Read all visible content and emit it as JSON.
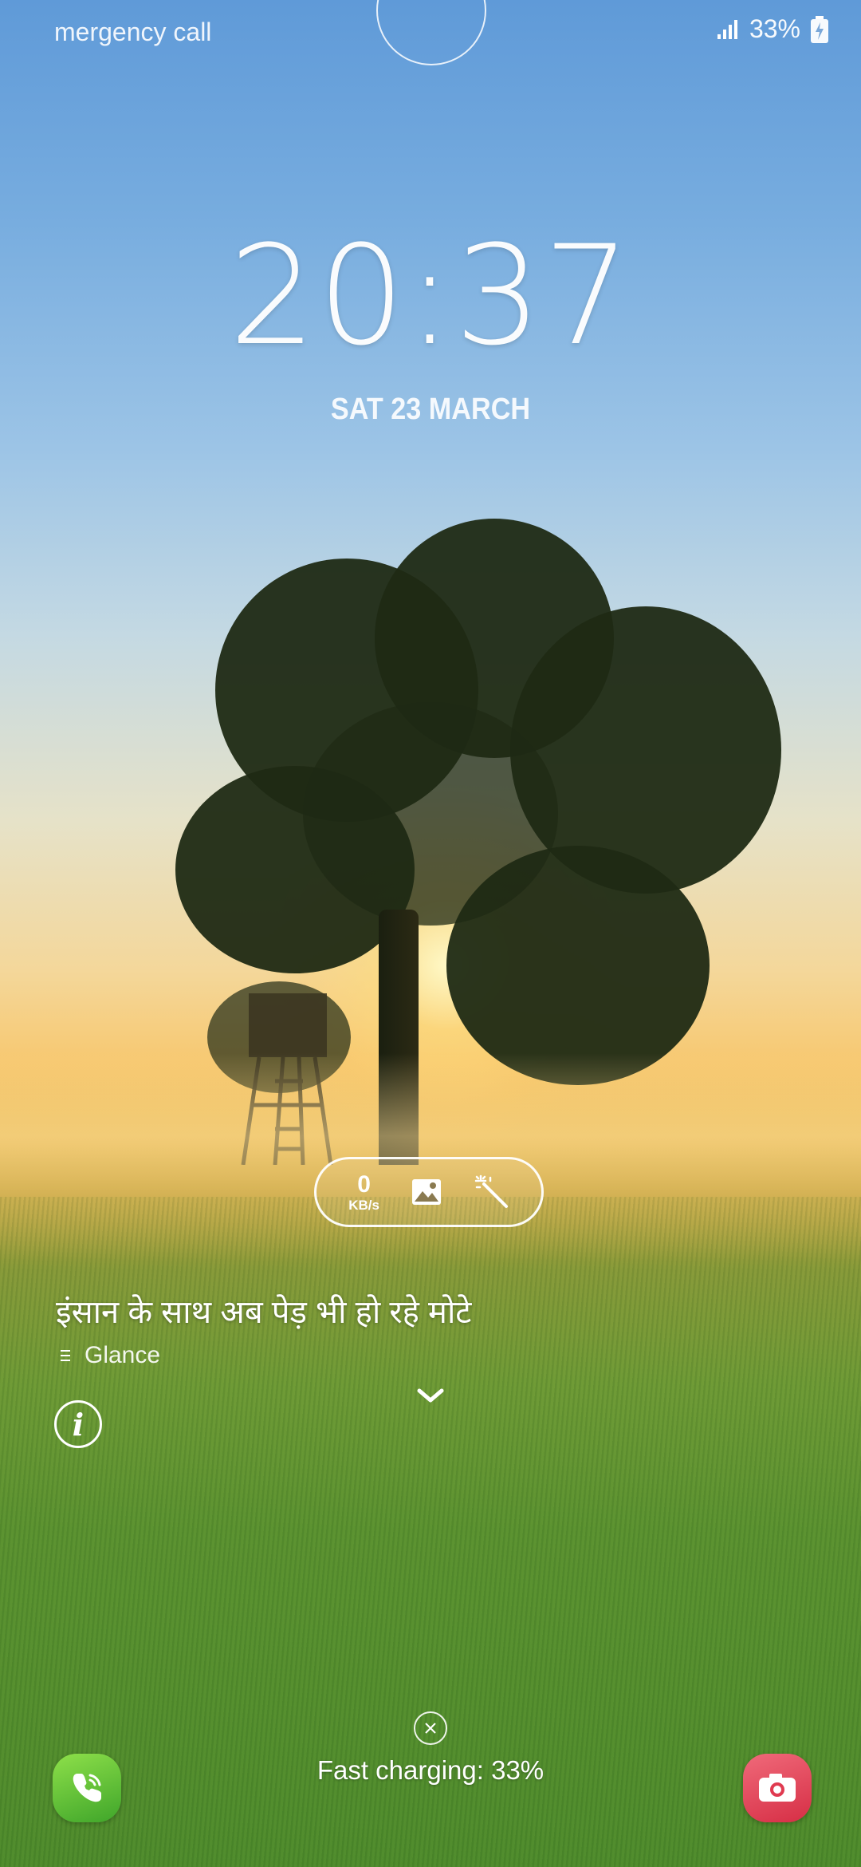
{
  "status_bar": {
    "left_text": "mergency call",
    "battery_text": "33%",
    "icons": [
      "signal-icon",
      "battery-charging-icon"
    ]
  },
  "lockscreen": {
    "time": "20:37",
    "date": "SAT 23 MARCH"
  },
  "quick_pill": {
    "speed_value": "0",
    "speed_unit": "KB/s",
    "icons": [
      "gallery-icon",
      "magic-wand-icon"
    ]
  },
  "glance_card": {
    "headline": "इंसान के साथ अब पेड़ भी हो रहे मोटे",
    "source": "Glance"
  },
  "footer": {
    "charging_text": "Fast charging: 33%",
    "shortcuts": [
      "phone-icon",
      "camera-icon"
    ]
  },
  "colors": {
    "phone_shortcut": "#4cb52c",
    "camera_shortcut": "#e03a50"
  }
}
